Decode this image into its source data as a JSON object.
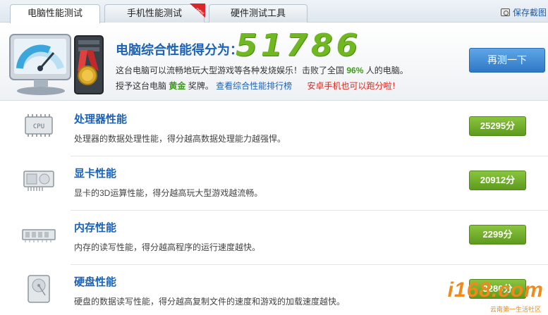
{
  "tabs": [
    {
      "label": "电脑性能测试",
      "active": true
    },
    {
      "label": "手机性能测试",
      "badge": "new"
    },
    {
      "label": "硬件测试工具"
    }
  ],
  "toolbar": {
    "save_screenshot": "保存截图",
    "save_icon": "camera-icon"
  },
  "header": {
    "score_title": "电脑综合性能得分为：",
    "score_value": "51786",
    "line1_prefix": "这台电脑可以流畅地玩大型游戏等各种发烧娱乐！击败了全国",
    "line1_percent": "96%",
    "line1_suffix": "人的电脑。",
    "line2_prefix": "授予这台电脑",
    "line2_medal": "黄金",
    "line2_after_medal": "奖牌。",
    "ranking_link": "查看综合性能排行榜",
    "android_link": "安卓手机也可以跑分啦！",
    "retest_button": "再测一下"
  },
  "rows": [
    {
      "title": "处理器性能",
      "desc": "处理器的数据处理性能，得分越高数据处理能力越强悍。",
      "score": "25295分",
      "icon": "cpu-icon"
    },
    {
      "title": "显卡性能",
      "desc": "显卡的3D运算性能，得分越高玩大型游戏越流畅。",
      "score": "20912分",
      "icon": "graphics-card-icon"
    },
    {
      "title": "内存性能",
      "desc": "内存的读写性能，得分越高程序的运行速度越快。",
      "score": "2299分",
      "icon": "memory-icon"
    },
    {
      "title": "硬盘性能",
      "desc": "硬盘的数据读写性能，得分越高复制文件的速度和游戏的加载速度越快。",
      "score": "3280分",
      "icon": "hard-disk-icon"
    }
  ],
  "watermark": {
    "text": "i168.com",
    "sub": "云南第一生活社区"
  },
  "colors": {
    "accent_blue": "#1c63b7",
    "score_green": "#6fb822",
    "badge_green": "#6ea82a",
    "warning_red": "#e0261b"
  }
}
